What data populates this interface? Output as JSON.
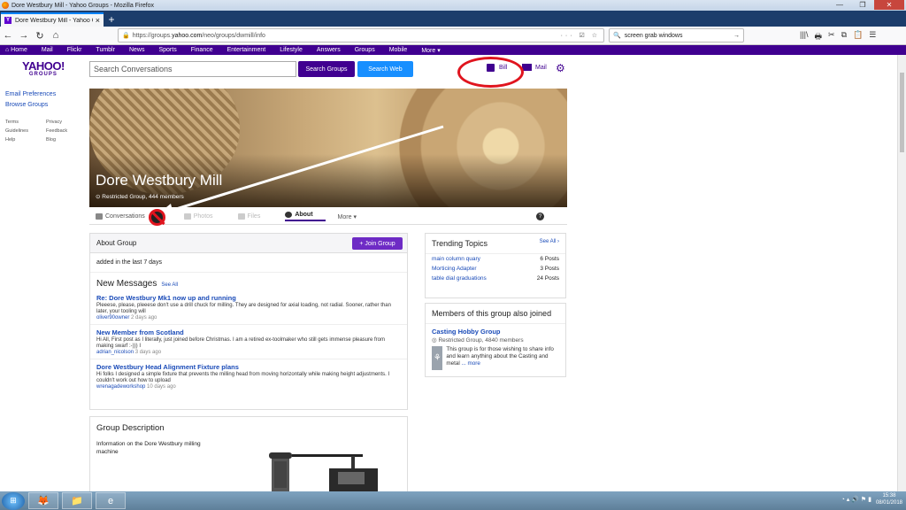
{
  "window": {
    "title": "Dore Westbury Mill - Yahoo Groups - Mozilla Firefox"
  },
  "tab": {
    "label": "Dore Westbury Mill - Yahoo Gr",
    "close": "×",
    "new": "+"
  },
  "nav": {
    "back": "←",
    "forward": "→",
    "reload": "↻",
    "home": "⌂"
  },
  "url": {
    "prefix": "https://groups.",
    "domain": "yahoo.com",
    "path": "/neo/groups/dwmill/info",
    "extra": "··· ☑ ☆"
  },
  "search": {
    "value": "screen grab windows",
    "go": "→"
  },
  "toolbar_icons": [
    "|||\\",
    "🖶",
    "✂",
    "⧉",
    "📋",
    "☰"
  ],
  "yahoo_bar": {
    "items": [
      "⌂ Home",
      "Mail",
      "Flickr",
      "Tumblr",
      "News",
      "Sports",
      "Finance",
      "Entertainment",
      "Lifestyle",
      "Answers",
      "Groups",
      "Mobile",
      "More ▾"
    ]
  },
  "header": {
    "logo": "YAHOO!",
    "logo_sub": "GROUPS",
    "search_placeholder": "Search Conversations",
    "search_groups": "Search Groups",
    "search_web": "Search Web",
    "user": "Bill",
    "mail": "Mail"
  },
  "leftnav": {
    "links": [
      "Email Preferences",
      "Browse Groups"
    ],
    "small": [
      "Terms",
      "Privacy",
      "Guidelines",
      "Feedback",
      "Help",
      "Blog"
    ]
  },
  "group": {
    "name": "Dore Westbury Mill",
    "meta": "Restricted Group, 444 members"
  },
  "subnav": {
    "conversations": "Conversations",
    "photos": "Photos",
    "files": "Files",
    "about": "About",
    "more": "More ▾",
    "help": "?"
  },
  "about": {
    "title": "About Group",
    "join": "+ Join Group",
    "added": "added in the last 7 days",
    "new_messages": "New Messages",
    "see_all": "See All",
    "messages": [
      {
        "title": "Re: Dore Westbury Mk1 now up and running",
        "body": "Pleeese, please, pleeese don't use a drill chuck for milling. They are designed for axial loading, not radial. Sooner, rather than later, your tooling will",
        "author": "oliver90owner",
        "time": "2 days ago"
      },
      {
        "title": "New Member from Scotland",
        "body": "Hi All, First post as I literally, just joined before Christmas. I am a retired ex-toolmaker who still gets immense pleasure from making swarf :-))) I",
        "author": "adrian_nicolson",
        "time": "3 days ago"
      },
      {
        "title": "Dore Westbury Head Alignment Fixture plans",
        "body": "Hi folks I designed a simple fixture that prevents the milling head from moving horizontally while making height adjustments. I couldn't work out how to upload",
        "author": "wrenagadeworkshop",
        "time": "10 days ago"
      }
    ]
  },
  "description": {
    "title": "Group Description",
    "text": "Information on the Dore Westbury milling machine"
  },
  "trending": {
    "title": "Trending Topics",
    "see_all": "See All ›",
    "topics": [
      {
        "name": "main column quary",
        "count": "6 Posts"
      },
      {
        "name": "Morticing Adapter",
        "count": "3 Posts"
      },
      {
        "name": "table dial graduations",
        "count": "24 Posts"
      }
    ]
  },
  "members": {
    "title": "Members of this group also joined",
    "group_name": "Casting Hobby Group",
    "group_meta": "Restricted Group, 4840 members",
    "group_desc": "This group is for those wishing to share info and learn anything about the Casting and metal",
    "more": "... more"
  },
  "taskbar": {
    "time": "15:38",
    "date": "08/01/2018"
  },
  "colors": {
    "yahoo_purple": "#400090",
    "annotation_red": "#e0141e",
    "link_blue": "#1a4bb8",
    "search_web_blue": "#188fff"
  }
}
